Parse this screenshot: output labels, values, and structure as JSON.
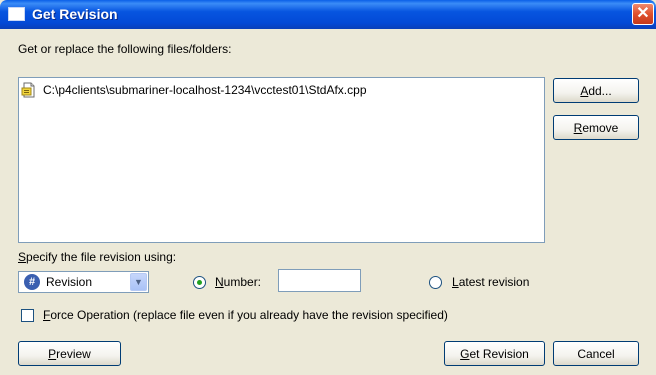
{
  "window": {
    "title": "Get Revision",
    "close_glyph": "✕"
  },
  "files": {
    "label": "Get or replace the following files/folders:",
    "items": [
      {
        "path": "C:\\p4clients\\submariner-localhost-1234\\vcctest01\\StdAfx.cpp",
        "icon": "document-icon"
      }
    ]
  },
  "buttons": {
    "add": {
      "access": "A",
      "rest": "dd..."
    },
    "remove": {
      "access": "R",
      "rest": "emove"
    },
    "preview": {
      "access": "P",
      "rest": "review"
    },
    "get_revision": {
      "access": "G",
      "rest": "et Revision"
    },
    "cancel": "Cancel"
  },
  "revision": {
    "label_access": "S",
    "label_rest": "pecify the file revision using:",
    "selected_type": "Revision",
    "type_icon": "hash-icon",
    "number_access": "N",
    "number_rest": "umber:",
    "number_value": "",
    "number_checked": true,
    "latest_access": "L",
    "latest_rest": "atest revision",
    "latest_checked": false
  },
  "force": {
    "access": "F",
    "rest": "orce Operation (replace file even if you already have the revision specified)",
    "checked": false
  }
}
